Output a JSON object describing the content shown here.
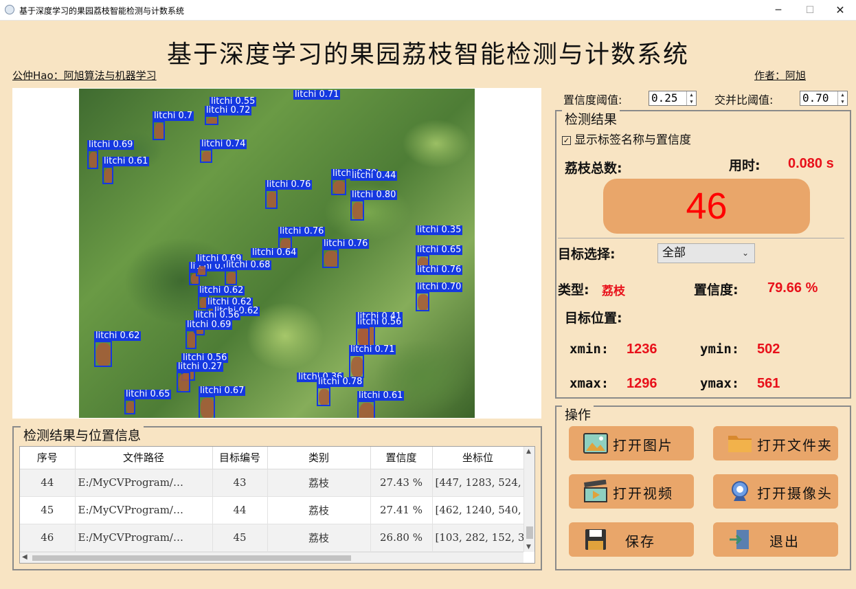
{
  "window": {
    "title": "基于深度学习的果园荔枝智能检测与计数系统",
    "min": "─",
    "max": "☐",
    "close": "✕"
  },
  "header": {
    "title": "基于深度学习的果园荔枝智能检测与计数系统",
    "left_caption": "公仲Hao：阿旭算法与机器学习",
    "right_caption": "作者：阿旭"
  },
  "detections": [
    {
      "label": "litchi 0.71"
    },
    {
      "label": "litchi 0.55"
    },
    {
      "label": "litchi 0.72"
    },
    {
      "label": "litchi 0.7"
    },
    {
      "label": "litchi 0.69"
    },
    {
      "label": "litchi 0.61"
    },
    {
      "label": "litchi 0.74"
    },
    {
      "label": "litchi 0.70"
    },
    {
      "label": "litchi 0.44"
    },
    {
      "label": "litchi 0.76"
    },
    {
      "label": "litchi 0.80"
    },
    {
      "label": "litchi 0.76"
    },
    {
      "label": "litchi 0.35"
    },
    {
      "label": "litchi 0.76"
    },
    {
      "label": "litchi 0.65"
    },
    {
      "label": "litchi 0.62"
    },
    {
      "label": "litchi 0.64"
    },
    {
      "label": "litchi 0.69"
    },
    {
      "label": "litchi 0.68"
    },
    {
      "label": "litchi 0.76"
    },
    {
      "label": "litchi 0.70"
    },
    {
      "label": "litchi 0.62"
    },
    {
      "label": "litchi 0.62"
    },
    {
      "label": "litchi 0.62"
    },
    {
      "label": "litchi 0.56"
    },
    {
      "label": "litchi 0.69"
    },
    {
      "label": "litchi 0.41"
    },
    {
      "label": "litchi 0.56"
    },
    {
      "label": "litchi 0.62"
    },
    {
      "label": "litchi 0.71"
    },
    {
      "label": "litchi 0.56"
    },
    {
      "label": "litchi 0.27"
    },
    {
      "label": "litchi 0.65"
    },
    {
      "label": "litchi 0.67"
    },
    {
      "label": "litchi 0.36"
    },
    {
      "label": "litchi 0.78"
    },
    {
      "label": "litchi 0.61"
    }
  ],
  "results_table": {
    "group_title": "检测结果与位置信息",
    "columns": [
      "序号",
      "文件路径",
      "目标编号",
      "类别",
      "置信度",
      "坐标位"
    ],
    "rows": [
      [
        "44",
        "E:/MyCVProgram/…",
        "43",
        "荔枝",
        "27.43 %",
        "[447, 1283, 524, 1"
      ],
      [
        "45",
        "E:/MyCVProgram/…",
        "44",
        "荔枝",
        "27.41 %",
        "[462, 1240, 540, 1"
      ],
      [
        "46",
        "E:/MyCVProgram/…",
        "45",
        "荔枝",
        "26.80 %",
        "[103, 282, 152, 32"
      ]
    ]
  },
  "thresholds": {
    "conf_label": "置信度阈值:",
    "conf_value": "0.25",
    "iou_label": "交并比阈值:",
    "iou_value": "0.70"
  },
  "detection_result": {
    "group_title": "检测结果",
    "show_labels": "显示标签名称与置信度",
    "count_label": "荔枝总数:",
    "time_label": "用时:",
    "time_value": "0.080 s",
    "count_value": "46",
    "target_label": "目标选择:",
    "target_value": "全部",
    "type_label": "类型:",
    "type_value": "荔枝",
    "conf_label": "置信度:",
    "conf_value": "79.66 %",
    "position_label": "目标位置:",
    "xmin_label": "xmin:",
    "xmin": "1236",
    "ymin_label": "ymin:",
    "ymin": "502",
    "xmax_label": "xmax:",
    "xmax": "1296",
    "ymax_label": "ymax:",
    "ymax": "561"
  },
  "operations": {
    "group_title": "操作",
    "open_image": "打开图片",
    "open_folder": "打开文件夹",
    "open_video": "打开视频",
    "open_camera": "打开摄像头",
    "save": "保存",
    "exit": "退出"
  },
  "colors": {
    "background": "#f8e4c3",
    "button": "#e9a66a",
    "value_red": "#e8101a",
    "box_blue": "#1538e0"
  }
}
